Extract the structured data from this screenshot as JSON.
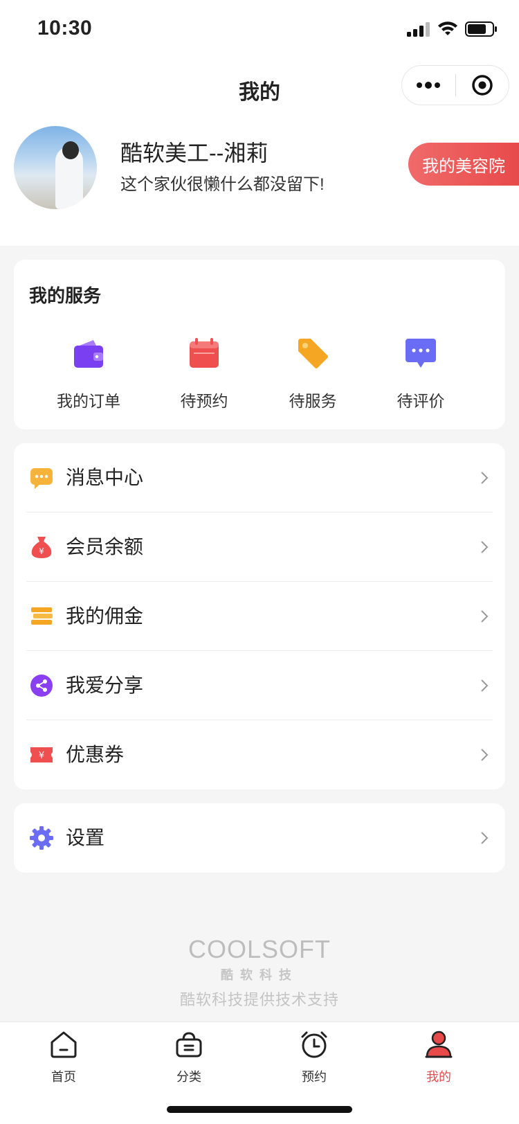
{
  "status_bar": {
    "time": "10:30"
  },
  "nav": {
    "title": "我的",
    "more_icon": "more-dots-icon",
    "close_icon": "target-close-icon"
  },
  "profile": {
    "name": "酷软美工--湘莉",
    "signature": "这个家伙很懒什么都没留下!",
    "salon_button": "我的美容院"
  },
  "services": {
    "title": "我的服务",
    "items": [
      {
        "label": "我的订单",
        "icon": "wallet-icon",
        "color": "#7b3ff2"
      },
      {
        "label": "待预约",
        "icon": "calendar-icon",
        "color": "#ef4f4f"
      },
      {
        "label": "待服务",
        "icon": "tag-icon",
        "color": "#f5a623"
      },
      {
        "label": "待评价",
        "icon": "comment-icon",
        "color": "#6b6cf6"
      }
    ]
  },
  "menu": {
    "items": [
      {
        "label": "消息中心",
        "icon": "message-icon",
        "color": "#f5b33b"
      },
      {
        "label": "会员余额",
        "icon": "money-bag-icon",
        "color": "#ef4f4f"
      },
      {
        "label": "我的佣金",
        "icon": "coins-stack-icon",
        "color": "#f5a623"
      },
      {
        "label": "我爱分享",
        "icon": "share-icon",
        "color": "#8a3ff2"
      },
      {
        "label": "优惠券",
        "icon": "coupon-icon",
        "color": "#ef4f4f"
      }
    ],
    "settings": {
      "label": "设置",
      "icon": "gear-icon",
      "color": "#6b6cf6"
    }
  },
  "footer": {
    "logo_text": "COOLSOFT",
    "logo_cn": "酷软科技",
    "support": "酷软科技提供技术支持"
  },
  "tabbar": {
    "items": [
      {
        "label": "首页",
        "icon": "home-icon",
        "active": false
      },
      {
        "label": "分类",
        "icon": "basket-icon",
        "active": false
      },
      {
        "label": "预约",
        "icon": "alarm-clock-icon",
        "active": false
      },
      {
        "label": "我的",
        "icon": "user-icon",
        "active": true
      }
    ]
  }
}
